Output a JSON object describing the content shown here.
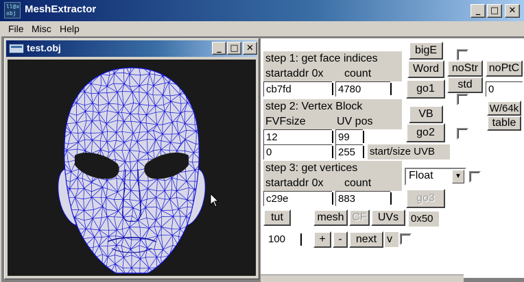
{
  "app": {
    "title": "MeshExtractor",
    "icon_text_line1": "ll@x",
    "icon_text_line2": "obj",
    "window_buttons": {
      "minimize": "_",
      "maximize": "□",
      "close": "✕"
    }
  },
  "menu": {
    "items": [
      "File",
      "Misc",
      "Help"
    ]
  },
  "child_window": {
    "title": "test.obj",
    "buttons": {
      "minimize": "_",
      "maximize": "□",
      "close": "✕"
    }
  },
  "colors": {
    "mesh_wire": "#1010d8",
    "mesh_fill": "#d8d8e8",
    "viewport_bg": "#1a1a1a",
    "title_blue": "#0a246a"
  },
  "step1": {
    "title": "step 1: get face indices",
    "startaddr_label": "startaddr 0x",
    "count_label": "count",
    "startaddr_value": "cb7fd",
    "count_value": "4780"
  },
  "step2": {
    "title": "step 2: Vertex Block",
    "fvfsize_label": "FVFsize",
    "uvpos_label": "UV pos",
    "fvfsize_value": "12",
    "uvpos_value": "99",
    "start_value": "0",
    "size_value": "255",
    "start_size_label": "start/size UVB"
  },
  "step3": {
    "title": "step 3: get vertices",
    "startaddr_label": "startaddr 0x",
    "count_label": "count",
    "startaddr_value": "c29e",
    "count_value": "883",
    "format_selected": "Float"
  },
  "buttons": {
    "bigE": "bigE",
    "word": "Word",
    "noStr": "noStr",
    "noPtC": "noPtC",
    "go1": "go1",
    "std": "std",
    "vb": "VB",
    "w64k": "W/64k",
    "table": "table",
    "go2": "go2",
    "go3": "go3",
    "tut": "tut",
    "mesh": "mesh",
    "cf": "CF",
    "uvs": "UVs",
    "plus": "+",
    "minus": "-",
    "next": "next",
    "v": "v"
  },
  "misc": {
    "noptc_value": "0",
    "hex_label": "0x50",
    "step_value": "100"
  }
}
